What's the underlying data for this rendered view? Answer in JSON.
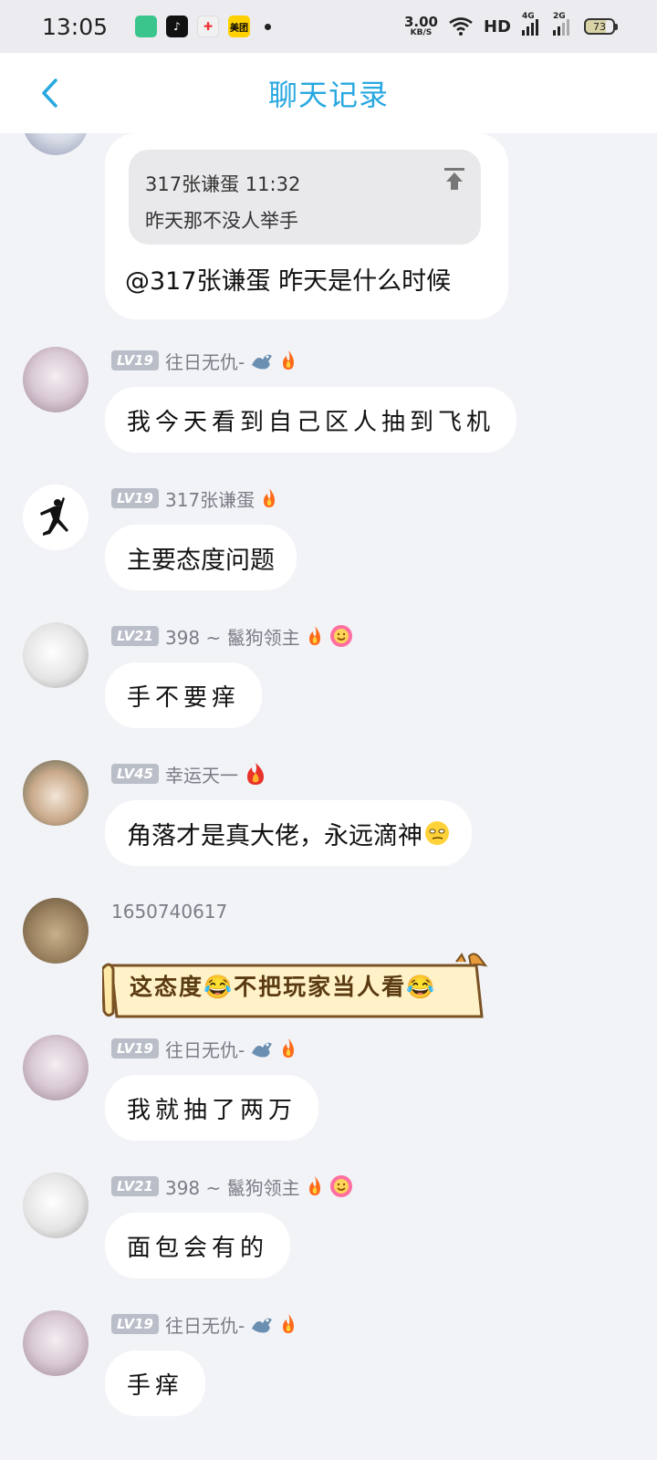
{
  "status_bar": {
    "time": "13:05",
    "net_speed_value": "3.00",
    "net_speed_unit": "KB/S",
    "hd": "HD",
    "sim1": "4G",
    "sim2": "2G",
    "battery": "73",
    "notif_icons": [
      "app-green-icon",
      "tiktok-icon",
      "game-icon",
      "meituan-icon"
    ],
    "meituan_label": "美团"
  },
  "header": {
    "title": "聊天记录"
  },
  "messages": [
    {
      "quote": {
        "author": "317张谦蛋",
        "time": "11:32",
        "text": "昨天那不没人举手"
      },
      "text": "@317张谦蛋 昨天是什么时候"
    },
    {
      "level": "LV19",
      "nick": "往日无仇-",
      "text": "我今天看到自己区人抽到飞机"
    },
    {
      "level": "LV19",
      "nick": "317张谦蛋",
      "text": "主要态度问题"
    },
    {
      "level": "LV21",
      "nick": "398 ~ 鬣狗领主",
      "text": "手不要痒"
    },
    {
      "level": "LV45",
      "nick": "幸运天一",
      "text": "角落才是真大佬，永远滴神"
    },
    {
      "nick": "1650740617",
      "text": "这态度😂不把玩家当人看😂"
    },
    {
      "level": "LV19",
      "nick": "往日无仇-",
      "text": "我就抽了两万"
    },
    {
      "level": "LV21",
      "nick": "398 ~ 鬣狗领主",
      "text": "面包会有的"
    },
    {
      "level": "LV19",
      "nick": "往日无仇-",
      "text": "手痒"
    }
  ],
  "colors": {
    "accent": "#28a8e0",
    "background": "#f2f3f7",
    "bubble": "#ffffff"
  }
}
